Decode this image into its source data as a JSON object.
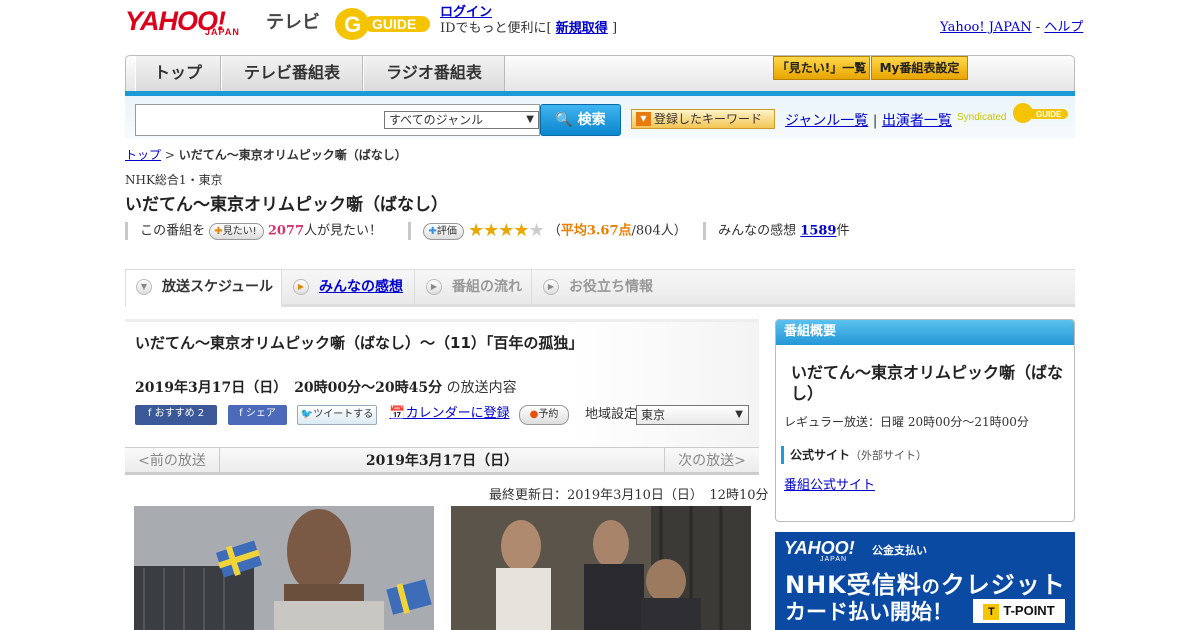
{
  "header": {
    "logo_yahoo": "YAHOO!",
    "logo_japan": "JAPAN",
    "logo_tv": "テレビ",
    "gguide_label": "GUIDE",
    "login": "ログイン",
    "login_sub_prefix": "IDでもっと便利に[",
    "signup": "新規取得",
    "login_sub_suffix": "]",
    "yahoo_japan_link": "Yahoo! JAPAN",
    "sep": "-",
    "help_link": "ヘルプ"
  },
  "nav": {
    "tabs": [
      "トップ",
      "テレビ番組表",
      "ラジオ番組表"
    ],
    "want_list": "「見たい!」一覧",
    "my_schedule": "My番組表設定"
  },
  "search": {
    "genre_selected": "すべてのジャンル",
    "button": "検索",
    "keywords_button": "登録したキーワード",
    "genre_list": "ジャンル一覧",
    "divider": "|",
    "cast_list": "出演者一覧",
    "syndicated": "Syndicated",
    "syndicated_logo": "GUIDE"
  },
  "breadcrumb": {
    "top": "トップ",
    "sep": ">",
    "current": "いだてん～東京オリムピック噺（ばなし）"
  },
  "program": {
    "channel": "NHK総合1・東京",
    "title": "いだてん～東京オリムピック噺（ばなし）",
    "want_prefix": "この番組を",
    "want_pill": "見たい!",
    "want_count": "2077",
    "want_suffix": "人が見たい！",
    "rate_pill": "評価",
    "rating": 3.67,
    "avg_open": "（",
    "avg_label": "平均3.67点",
    "avg_count": "/804人）",
    "impressions_label": "みんなの感想",
    "impressions_count": "1589",
    "impressions_unit": "件"
  },
  "tabs": [
    "放送スケジュール",
    "みんなの感想",
    "番組の流れ",
    "お役立ち情報"
  ],
  "episode": {
    "title": "いだてん～東京オリムピック噺（ばなし）～（11）「百年の孤独」",
    "date_bold": "2019年3月17日（日）　20時00分～20時45分",
    "date_suffix": "の放送内容",
    "fb_recommend": "おすすめ 2",
    "fb_share": "シェア",
    "tweet": "ツイートする",
    "calendar": "カレンダーに登録",
    "reserve": "予約",
    "region_label": "地域設定",
    "region_value": "東京",
    "prev": "<前の放送",
    "day": "2019年3月17日（日）",
    "next": "次の放送>",
    "updated": "最終更新日：2019年3月10日（日）　12時10分"
  },
  "sidebar": {
    "head": "番組概要",
    "title": "いだてん～東京オリムピック噺（ばなし）",
    "regular": "レギュラー放送：日曜 20時00分～21時00分",
    "official_label": "公式サイト",
    "official_note": "（外部サイト）",
    "official_link": "番組公式サイト"
  },
  "banner": {
    "yahoo": "YAHOO!",
    "japan": "JAPAN",
    "sub": "公金支払い",
    "line1a": "NHK受信料",
    "line1b": "の",
    "line1c": "クレジット",
    "line2": "カード払い開始！",
    "tpoint": "T-POINT",
    "tmark": "T"
  },
  "colors": {
    "accent_blue": "#1b9ad6",
    "yahoo_red": "#d9001b",
    "star": "#e8a800"
  }
}
